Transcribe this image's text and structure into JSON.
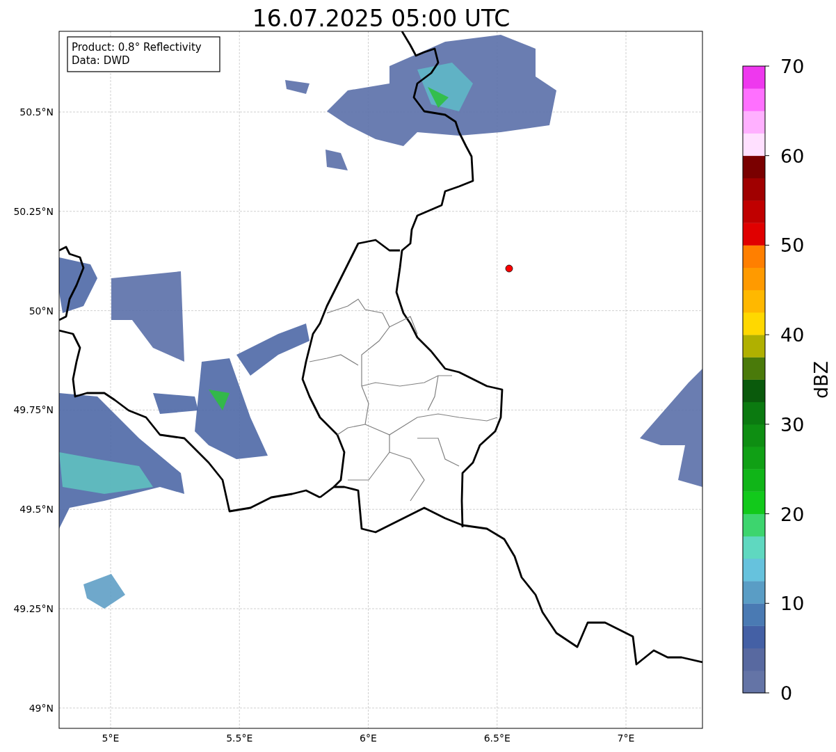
{
  "title": "16.07.2025 05:00 UTC",
  "info_box": {
    "lines": [
      "Product: 0.8° Reflectivity",
      "Data: DWD"
    ]
  },
  "map": {
    "xticks": [
      "5°E",
      "5.5°E",
      "6°E",
      "6.5°E",
      "7°E"
    ],
    "yticks": [
      "50.5°N",
      "50.25°N",
      "50°N",
      "49.75°N",
      "49.5°N",
      "49.25°N",
      "49°N"
    ]
  },
  "colorbar": {
    "label": "dBZ",
    "ticks": [
      "70",
      "60",
      "50",
      "40",
      "30",
      "20",
      "10",
      "0"
    ],
    "bands": [
      {
        "color": "#6474a6"
      },
      {
        "color": "#5869a0"
      },
      {
        "color": "#4460a5"
      },
      {
        "color": "#4a7ab3"
      },
      {
        "color": "#5a9dc5"
      },
      {
        "color": "#66c2dd"
      },
      {
        "color": "#5fd8c0"
      },
      {
        "color": "#3dd56e"
      },
      {
        "color": "#12c91b"
      },
      {
        "color": "#10b518"
      },
      {
        "color": "#10a015"
      },
      {
        "color": "#0e8e12"
      },
      {
        "color": "#0b7a10"
      },
      {
        "color": "#0a5a0c"
      },
      {
        "color": "#4a7a0a"
      },
      {
        "color": "#b0b000"
      },
      {
        "color": "#ffd800"
      },
      {
        "color": "#ffb800"
      },
      {
        "color": "#ff9a00"
      },
      {
        "color": "#ff7f00"
      },
      {
        "color": "#e00000"
      },
      {
        "color": "#c00000"
      },
      {
        "color": "#a00000"
      },
      {
        "color": "#7a0000"
      },
      {
        "color": "#ffe0ff"
      },
      {
        "color": "#ffb0ff"
      },
      {
        "color": "#ff70ff"
      },
      {
        "color": "#ee38ee"
      }
    ]
  }
}
